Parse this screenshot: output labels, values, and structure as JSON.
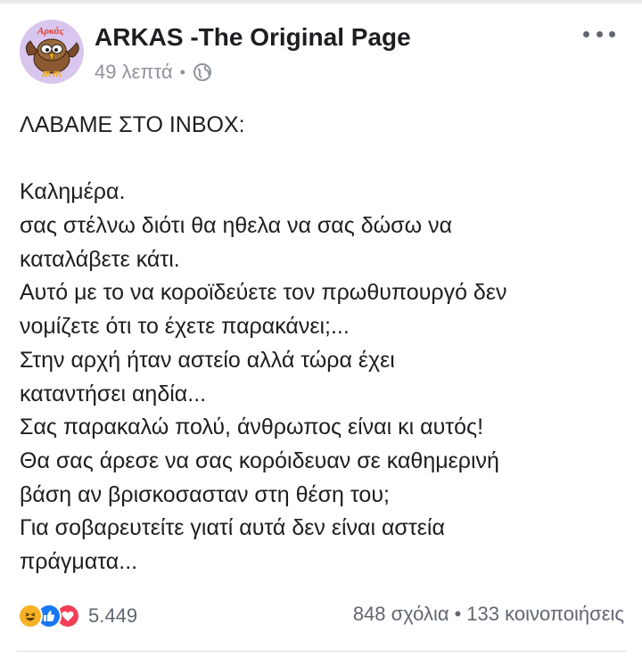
{
  "post": {
    "page_name": "ARKAS -The Original Page",
    "timestamp": "49 λεπτά",
    "meta_separator": "•",
    "privacy_icon": "globe-icon",
    "avatar_label": "Αρκάς",
    "lines": [
      "ΛΑΒΑΜΕ ΣΤΟ INBOX:",
      "",
      "Καλημέρα.",
      "σας στέλνω διότι θα ηθελα να σας δώσω να",
      "καταλάβετε κάτι.",
      "Αυτό με το να κοροϊδεύετε τον πρωθυπουργό δεν",
      "νομίζετε ότι το έχετε παρακάνει;...",
      "Στην αρχή ήταν αστείο αλλά τώρα έχει",
      "καταντήσει αηδία...",
      "Σας παρακαλώ πολύ, άνθρωπος είναι κι αυτός!",
      "Θα σας άρεσε να σας κορόιδευαν σε καθημερινή",
      "βάση αν βρισκοσασταν στη θέση του;",
      "Για σοβαρευτείτε γιατί αυτά δεν είναι αστεία",
      "πράγματα..."
    ]
  },
  "footer": {
    "reactions": [
      {
        "icon": "haha-reaction-icon",
        "color": "#f7b125"
      },
      {
        "icon": "like-reaction-icon",
        "color": "#1877f2"
      },
      {
        "icon": "love-reaction-icon",
        "color": "#f33e58"
      }
    ],
    "reaction_count": "5.449",
    "comments": "848 σχόλια",
    "separator": "•",
    "shares": "133 κοινοποιήσεις"
  }
}
